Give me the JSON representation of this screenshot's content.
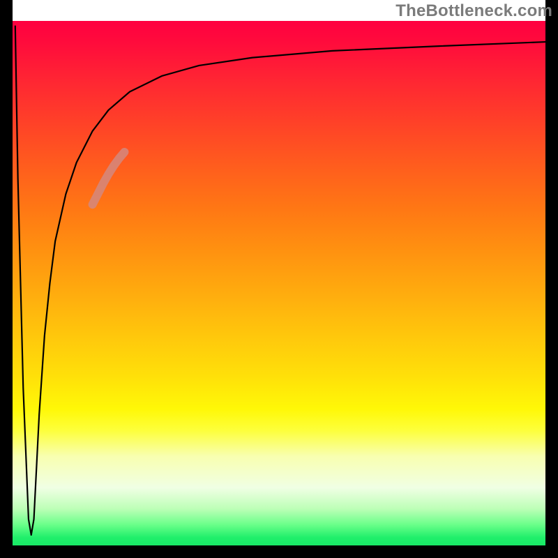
{
  "watermark": "TheBottleneck.com",
  "chart_data": {
    "type": "line",
    "title": "",
    "xlabel": "",
    "ylabel": "",
    "xlim": [
      0,
      100
    ],
    "ylim": [
      0,
      100
    ],
    "series": [
      {
        "name": "bottleneck-curve",
        "color": "#000000",
        "x": [
          0.5,
          1.0,
          2.0,
          3.0,
          3.5,
          4.0,
          4.5,
          5.0,
          6.0,
          7.0,
          8.0,
          10.0,
          12.0,
          15.0,
          18.0,
          22.0,
          28.0,
          35.0,
          45.0,
          60.0,
          80.0,
          100.0
        ],
        "y": [
          99.0,
          70.0,
          30.0,
          5.0,
          2.0,
          5.0,
          15.0,
          25.0,
          40.0,
          50.0,
          58.0,
          67.0,
          73.0,
          79.0,
          83.0,
          86.5,
          89.5,
          91.5,
          93.0,
          94.3,
          95.2,
          96.0
        ]
      },
      {
        "name": "highlight-segment",
        "color": "#d4887f",
        "x": [
          15.0,
          16.0,
          17.0,
          18.0,
          19.0,
          20.0,
          21.0
        ],
        "y": [
          65.0,
          67.0,
          69.0,
          70.8,
          72.4,
          73.8,
          75.0
        ]
      }
    ],
    "background_gradient": {
      "orientation": "vertical",
      "stops": [
        {
          "pos": 0.0,
          "color": "#ff0040"
        },
        {
          "pos": 0.2,
          "color": "#ff4327"
        },
        {
          "pos": 0.44,
          "color": "#ff9210"
        },
        {
          "pos": 0.68,
          "color": "#ffe109"
        },
        {
          "pos": 0.83,
          "color": "#f8ffb0"
        },
        {
          "pos": 0.96,
          "color": "#6bff8a"
        },
        {
          "pos": 1.0,
          "color": "#19e966"
        }
      ]
    }
  }
}
